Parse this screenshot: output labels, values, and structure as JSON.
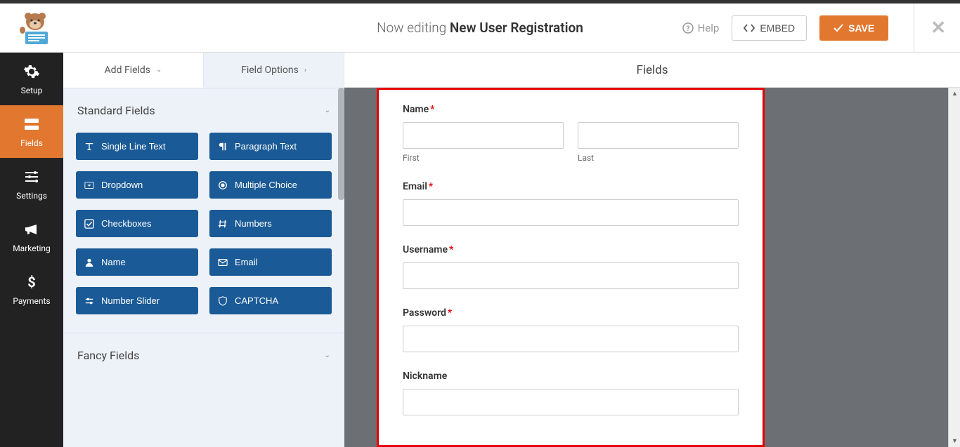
{
  "header": {
    "now_editing": "Now editing",
    "form_name": "New User Registration",
    "help": "Help",
    "embed": "EMBED",
    "save": "SAVE"
  },
  "sidebar": {
    "items": [
      {
        "label": "Setup"
      },
      {
        "label": "Fields"
      },
      {
        "label": "Settings"
      },
      {
        "label": "Marketing"
      },
      {
        "label": "Payments"
      }
    ]
  },
  "tabs": {
    "add_fields": "Add Fields",
    "field_options": "Field Options"
  },
  "groups": {
    "standard": "Standard Fields",
    "fancy": "Fancy Fields"
  },
  "field_buttons": [
    {
      "label": "Single Line Text"
    },
    {
      "label": "Paragraph Text"
    },
    {
      "label": "Dropdown"
    },
    {
      "label": "Multiple Choice"
    },
    {
      "label": "Checkboxes"
    },
    {
      "label": "Numbers"
    },
    {
      "label": "Name"
    },
    {
      "label": "Email"
    },
    {
      "label": "Number Slider"
    },
    {
      "label": "CAPTCHA"
    }
  ],
  "preview": {
    "title": "Fields",
    "fields": {
      "name_label": "Name",
      "first": "First",
      "last": "Last",
      "email": "Email",
      "username": "Username",
      "password": "Password",
      "nickname": "Nickname"
    }
  }
}
